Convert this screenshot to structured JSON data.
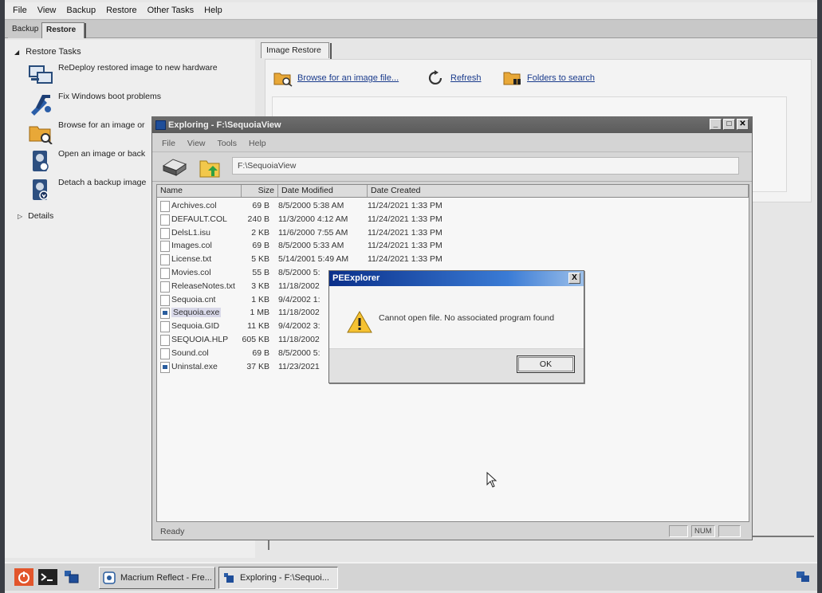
{
  "menubar": {
    "items": [
      "File",
      "View",
      "Backup",
      "Restore",
      "Other Tasks",
      "Help"
    ]
  },
  "tabs": {
    "backup": "Backup",
    "restore": "Restore"
  },
  "left_pane": {
    "section_title": "Restore Tasks",
    "tasks": [
      {
        "label": "ReDeploy restored image to new hardware",
        "icon": "redeploy-icon"
      },
      {
        "label": "Fix Windows boot problems",
        "icon": "tools-icon"
      },
      {
        "label": "Browse for an image or",
        "icon": "folder-search-icon"
      },
      {
        "label": "Open an image or back",
        "icon": "disk-open-icon"
      },
      {
        "label": "Detach a backup image",
        "icon": "disk-detach-icon"
      }
    ],
    "details_label": "Details"
  },
  "right_pane": {
    "tab": "Image Restore",
    "links": {
      "browse": "Browse for an image file...",
      "refresh": "Refresh",
      "folders": "Folders to search"
    }
  },
  "explorer": {
    "title": "Exploring - F:\\SequoiaView",
    "menu": [
      "File",
      "View",
      "Tools",
      "Help"
    ],
    "address": "F:\\SequoiaView",
    "columns": [
      "Name",
      "Size",
      "Date Modified",
      "Date Created"
    ],
    "files": [
      {
        "name": "Archives.col",
        "size": "69 B",
        "modified": "8/5/2000 5:38 AM",
        "created": "11/24/2021 1:33 PM",
        "type": "file"
      },
      {
        "name": "DEFAULT.COL",
        "size": "240 B",
        "modified": "11/3/2000 4:12 AM",
        "created": "11/24/2021 1:33 PM",
        "type": "file"
      },
      {
        "name": "DelsL1.isu",
        "size": "2 KB",
        "modified": "11/6/2000 7:55 AM",
        "created": "11/24/2021 1:33 PM",
        "type": "file"
      },
      {
        "name": "Images.col",
        "size": "69 B",
        "modified": "8/5/2000 5:33 AM",
        "created": "11/24/2021 1:33 PM",
        "type": "file"
      },
      {
        "name": "License.txt",
        "size": "5 KB",
        "modified": "5/14/2001 5:49 AM",
        "created": "11/24/2021 1:33 PM",
        "type": "file"
      },
      {
        "name": "Movies.col",
        "size": "55 B",
        "modified": "8/5/2000 5:",
        "created": "",
        "type": "file"
      },
      {
        "name": "ReleaseNotes.txt",
        "size": "3 KB",
        "modified": "11/18/2002",
        "created": "",
        "type": "file"
      },
      {
        "name": "Sequoia.cnt",
        "size": "1 KB",
        "modified": "9/4/2002 1:",
        "created": "",
        "type": "file"
      },
      {
        "name": "Sequoia.exe",
        "size": "1 MB",
        "modified": "11/18/2002",
        "created": "",
        "type": "exe",
        "selected": true
      },
      {
        "name": "Sequoia.GID",
        "size": "11 KB",
        "modified": "9/4/2002 3:",
        "created": "",
        "type": "file"
      },
      {
        "name": "SEQUOIA.HLP",
        "size": "605 KB",
        "modified": "11/18/2002",
        "created": "",
        "type": "file"
      },
      {
        "name": "Sound.col",
        "size": "69 B",
        "modified": "8/5/2000 5:",
        "created": "",
        "type": "file"
      },
      {
        "name": "Uninstal.exe",
        "size": "37 KB",
        "modified": "11/23/2021",
        "created": "",
        "type": "exe"
      }
    ],
    "status": "Ready",
    "status_num": "NUM"
  },
  "dialog": {
    "title": "PEExplorer",
    "message": "Cannot open file. No associated program found",
    "ok": "OK",
    "close_glyph": "X"
  },
  "taskbar": {
    "buttons": [
      {
        "label": "Macrium Reflect - Fre...",
        "active": false
      },
      {
        "label": "Exploring - F:\\Sequoi...",
        "active": true
      }
    ]
  }
}
